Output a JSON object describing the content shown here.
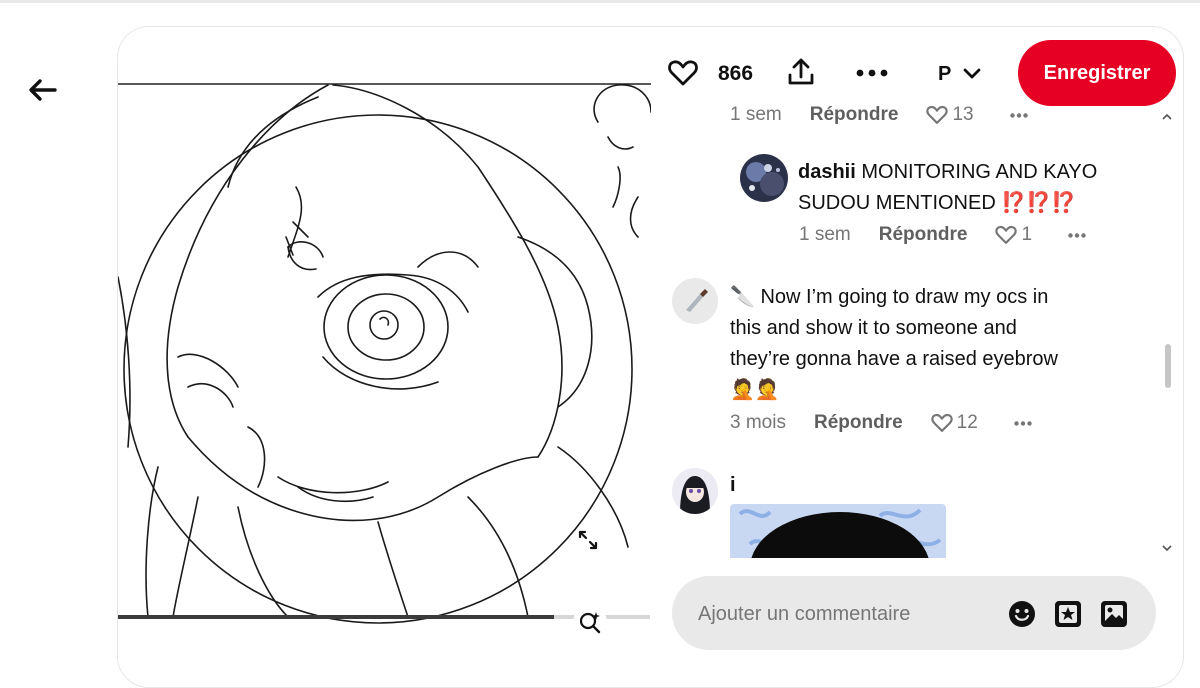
{
  "toolbar": {
    "like_count": "866",
    "board_initial": "P",
    "save_label": "Enregistrer"
  },
  "comments": {
    "top_meta": {
      "time": "1 sem",
      "reply": "Répondre",
      "likes": "13"
    },
    "reply_dashii": {
      "username": "dashii",
      "text": "MONITORING AND KAYO",
      "text_line2": "SUDOU MENTIONED",
      "emoji": "⁉️⁉️⁉️",
      "time": "1 sem",
      "reply": "Répondre",
      "likes": "1"
    },
    "knife_comment": {
      "line1": "🔪 Now I’m going to draw my ocs in",
      "line2": "this and show it to someone and",
      "line3": "they’re gonna have a raised eyebrow",
      "line4": "🤦🤦",
      "time": "3 mois",
      "reply": "Répondre",
      "likes": "12"
    },
    "i_comment": {
      "username": "i"
    }
  },
  "image": {
    "progress": 0.82
  },
  "composer": {
    "placeholder": "Ajouter un commentaire"
  },
  "colors": {
    "accent": "#e60023",
    "muted": "#767676",
    "composer_bg": "#e9e9e9"
  },
  "icons": [
    "back-arrow-icon",
    "heart-icon",
    "share-icon",
    "more-icon",
    "chevron-down-icon",
    "expand-icon",
    "visual-search-icon",
    "emoji-icon",
    "sticker-icon",
    "image-icon"
  ]
}
